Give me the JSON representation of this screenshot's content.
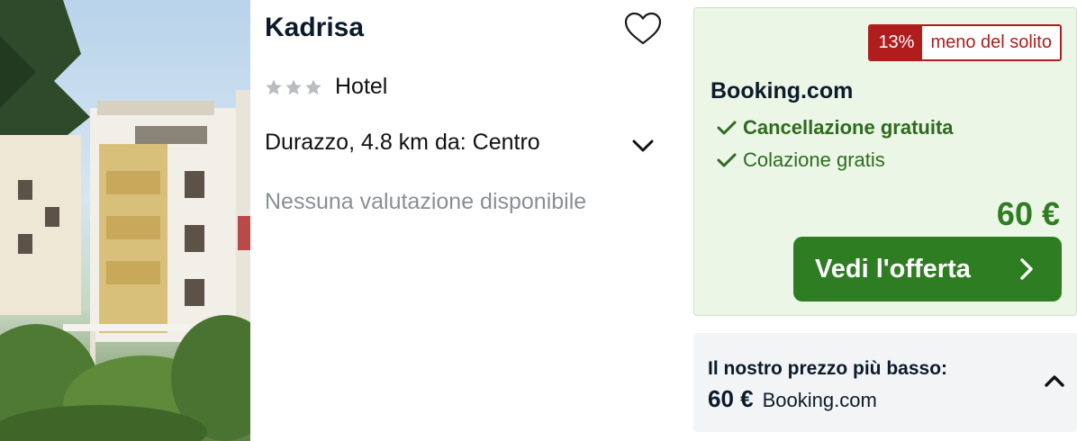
{
  "hotel": {
    "name": "Kadrisa",
    "stars": 3,
    "type": "Hotel",
    "location": "Durazzo, 4.8 km da: Centro",
    "rating_text": "Nessuna valutazione disponibile"
  },
  "offer": {
    "badge_percent": "13%",
    "badge_text": "meno del solito",
    "provider": "Booking.com",
    "features": [
      "Cancellazione gratuita",
      "Colazione gratis"
    ],
    "price": "60 €",
    "cta_label": "Vedi l'offerta"
  },
  "lowest_price": {
    "title": "Il nostro prezzo più basso:",
    "amount": "60 €",
    "provider": "Booking.com"
  },
  "icons": {
    "favorite": "heart-icon",
    "expand_location": "chevron-down-icon",
    "cta_arrow": "chevron-right-icon",
    "collapse": "chevron-up-icon",
    "feature_check": "checkmark-icon"
  },
  "colors": {
    "accent_green": "#2e7d22",
    "deal_red": "#b01d1d",
    "offer_background": "#ecf6e6"
  }
}
